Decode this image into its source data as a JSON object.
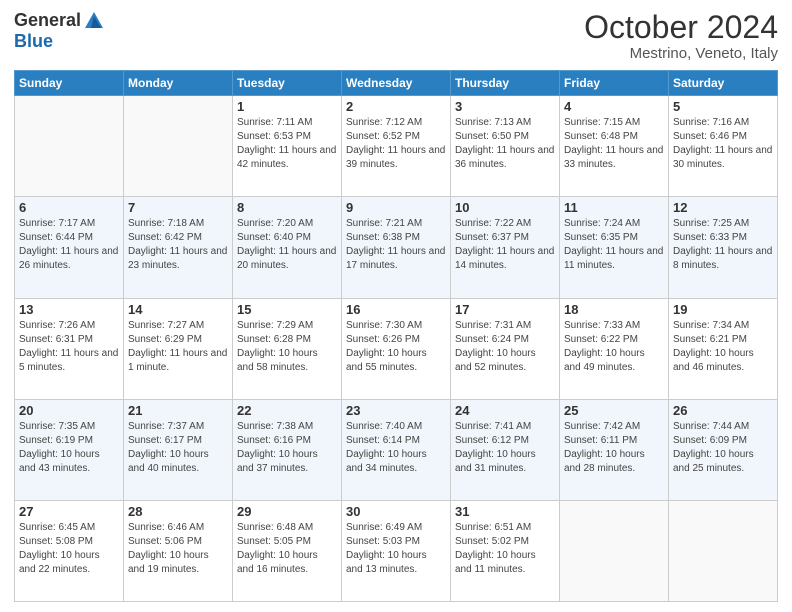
{
  "header": {
    "logo_general": "General",
    "logo_blue": "Blue",
    "title": "October 2024",
    "location": "Mestrino, Veneto, Italy"
  },
  "days_of_week": [
    "Sunday",
    "Monday",
    "Tuesday",
    "Wednesday",
    "Thursday",
    "Friday",
    "Saturday"
  ],
  "weeks": [
    [
      {
        "day": "",
        "info": ""
      },
      {
        "day": "",
        "info": ""
      },
      {
        "day": "1",
        "info": "Sunrise: 7:11 AM\nSunset: 6:53 PM\nDaylight: 11 hours and 42 minutes."
      },
      {
        "day": "2",
        "info": "Sunrise: 7:12 AM\nSunset: 6:52 PM\nDaylight: 11 hours and 39 minutes."
      },
      {
        "day": "3",
        "info": "Sunrise: 7:13 AM\nSunset: 6:50 PM\nDaylight: 11 hours and 36 minutes."
      },
      {
        "day": "4",
        "info": "Sunrise: 7:15 AM\nSunset: 6:48 PM\nDaylight: 11 hours and 33 minutes."
      },
      {
        "day": "5",
        "info": "Sunrise: 7:16 AM\nSunset: 6:46 PM\nDaylight: 11 hours and 30 minutes."
      }
    ],
    [
      {
        "day": "6",
        "info": "Sunrise: 7:17 AM\nSunset: 6:44 PM\nDaylight: 11 hours and 26 minutes."
      },
      {
        "day": "7",
        "info": "Sunrise: 7:18 AM\nSunset: 6:42 PM\nDaylight: 11 hours and 23 minutes."
      },
      {
        "day": "8",
        "info": "Sunrise: 7:20 AM\nSunset: 6:40 PM\nDaylight: 11 hours and 20 minutes."
      },
      {
        "day": "9",
        "info": "Sunrise: 7:21 AM\nSunset: 6:38 PM\nDaylight: 11 hours and 17 minutes."
      },
      {
        "day": "10",
        "info": "Sunrise: 7:22 AM\nSunset: 6:37 PM\nDaylight: 11 hours and 14 minutes."
      },
      {
        "day": "11",
        "info": "Sunrise: 7:24 AM\nSunset: 6:35 PM\nDaylight: 11 hours and 11 minutes."
      },
      {
        "day": "12",
        "info": "Sunrise: 7:25 AM\nSunset: 6:33 PM\nDaylight: 11 hours and 8 minutes."
      }
    ],
    [
      {
        "day": "13",
        "info": "Sunrise: 7:26 AM\nSunset: 6:31 PM\nDaylight: 11 hours and 5 minutes."
      },
      {
        "day": "14",
        "info": "Sunrise: 7:27 AM\nSunset: 6:29 PM\nDaylight: 11 hours and 1 minute."
      },
      {
        "day": "15",
        "info": "Sunrise: 7:29 AM\nSunset: 6:28 PM\nDaylight: 10 hours and 58 minutes."
      },
      {
        "day": "16",
        "info": "Sunrise: 7:30 AM\nSunset: 6:26 PM\nDaylight: 10 hours and 55 minutes."
      },
      {
        "day": "17",
        "info": "Sunrise: 7:31 AM\nSunset: 6:24 PM\nDaylight: 10 hours and 52 minutes."
      },
      {
        "day": "18",
        "info": "Sunrise: 7:33 AM\nSunset: 6:22 PM\nDaylight: 10 hours and 49 minutes."
      },
      {
        "day": "19",
        "info": "Sunrise: 7:34 AM\nSunset: 6:21 PM\nDaylight: 10 hours and 46 minutes."
      }
    ],
    [
      {
        "day": "20",
        "info": "Sunrise: 7:35 AM\nSunset: 6:19 PM\nDaylight: 10 hours and 43 minutes."
      },
      {
        "day": "21",
        "info": "Sunrise: 7:37 AM\nSunset: 6:17 PM\nDaylight: 10 hours and 40 minutes."
      },
      {
        "day": "22",
        "info": "Sunrise: 7:38 AM\nSunset: 6:16 PM\nDaylight: 10 hours and 37 minutes."
      },
      {
        "day": "23",
        "info": "Sunrise: 7:40 AM\nSunset: 6:14 PM\nDaylight: 10 hours and 34 minutes."
      },
      {
        "day": "24",
        "info": "Sunrise: 7:41 AM\nSunset: 6:12 PM\nDaylight: 10 hours and 31 minutes."
      },
      {
        "day": "25",
        "info": "Sunrise: 7:42 AM\nSunset: 6:11 PM\nDaylight: 10 hours and 28 minutes."
      },
      {
        "day": "26",
        "info": "Sunrise: 7:44 AM\nSunset: 6:09 PM\nDaylight: 10 hours and 25 minutes."
      }
    ],
    [
      {
        "day": "27",
        "info": "Sunrise: 6:45 AM\nSunset: 5:08 PM\nDaylight: 10 hours and 22 minutes."
      },
      {
        "day": "28",
        "info": "Sunrise: 6:46 AM\nSunset: 5:06 PM\nDaylight: 10 hours and 19 minutes."
      },
      {
        "day": "29",
        "info": "Sunrise: 6:48 AM\nSunset: 5:05 PM\nDaylight: 10 hours and 16 minutes."
      },
      {
        "day": "30",
        "info": "Sunrise: 6:49 AM\nSunset: 5:03 PM\nDaylight: 10 hours and 13 minutes."
      },
      {
        "day": "31",
        "info": "Sunrise: 6:51 AM\nSunset: 5:02 PM\nDaylight: 10 hours and 11 minutes."
      },
      {
        "day": "",
        "info": ""
      },
      {
        "day": "",
        "info": ""
      }
    ]
  ]
}
